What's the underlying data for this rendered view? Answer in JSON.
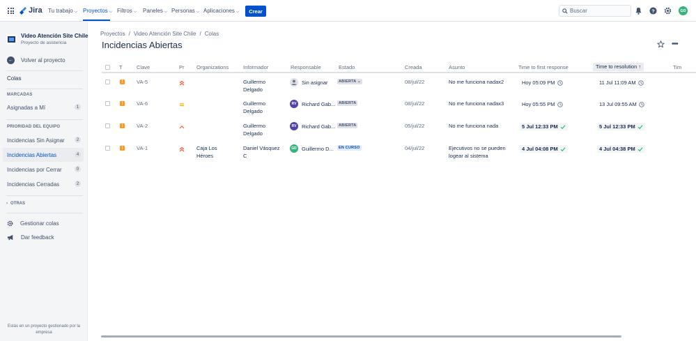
{
  "topnav": {
    "logo": "Jira",
    "items": [
      "Tu trabajo",
      "Proyectos",
      "Filtros",
      "Paneles",
      "Personas",
      "Aplicaciones"
    ],
    "create": "Crear",
    "search_placeholder": "Buscar",
    "user_initials": "GD"
  },
  "sidebar": {
    "project_name": "Video Atención Site Chile",
    "project_type": "Proyecto de asistencia",
    "back": "Volver al proyecto",
    "colas": "Colas",
    "section_marked": "MARCADAS",
    "marked_items": [
      {
        "label": "Asignadas a Mí",
        "count": "1"
      }
    ],
    "section_priority": "PRIORIDAD DEL EQUIPO",
    "priority_items": [
      {
        "label": "Incidencias Sin Asignar",
        "count": "2"
      },
      {
        "label": "Incidencias Abiertas",
        "count": "4"
      },
      {
        "label": "Incidencias por Cerrar",
        "count": "0"
      },
      {
        "label": "Incidencias Cerradas",
        "count": "2"
      }
    ],
    "otras": "OTRAS",
    "manage": "Gestionar colas",
    "feedback": "Dar feedback",
    "footer": "Estás en un proyecto gestionado por la empresa"
  },
  "breadcrumb": [
    "Proyectos",
    "Video Atención Site Chile",
    "Colas"
  ],
  "page_title": "Incidencias Abiertas",
  "table": {
    "headers": {
      "t": "T",
      "key": "Clave",
      "pr": "Pr",
      "org": "Organizations",
      "reporter": "Informador",
      "assignee": "Responsable",
      "status": "Estado",
      "created": "Creada",
      "summary": "Asunto",
      "first_response": "Time to first response",
      "resolution": "Time to resolution",
      "next": "Tim"
    },
    "rows": [
      {
        "key": "VA-5",
        "priority": "highest",
        "org": "",
        "reporter_1": "Guillermo",
        "reporter_2": "Delgado",
        "assignee": "Sin asignar",
        "assignee_initials": "",
        "status": "ABIERTA",
        "created": "08/jul/22",
        "summary_1": "No me funciona nadax2",
        "summary_2": "",
        "first_response": "Hoy 05:09 PM",
        "first_state": "clock",
        "resolution": "11 Jul 11:09 AM",
        "resolution_state": "clock"
      },
      {
        "key": "VA-6",
        "priority": "medium",
        "org": "",
        "reporter_1": "Guillermo",
        "reporter_2": "Delgado",
        "assignee": "Richard Gab...",
        "assignee_initials": "RV",
        "status": "ABIERTA",
        "created": "08/jul/22",
        "summary_1": "No me funciona nadax3",
        "summary_2": "",
        "first_response": "Hoy 05:55 PM",
        "first_state": "clock",
        "resolution": "13 Jul 09:55 AM",
        "resolution_state": "clock"
      },
      {
        "key": "VA-2",
        "priority": "high",
        "org": "",
        "reporter_1": "Guillermo",
        "reporter_2": "Delgado",
        "assignee": "Richard Gab...",
        "assignee_initials": "RV",
        "status": "ABIERTA",
        "created": "05/jul/22",
        "summary_1": "No me funciona nada",
        "summary_2": "",
        "first_response": "5 Jul 12:33 PM",
        "first_state": "check",
        "resolution": "5 Jul 12:33 PM",
        "resolution_state": "check"
      },
      {
        "key": "VA-1",
        "priority": "highest",
        "org_1": "Caja Los",
        "org_2": "Héroes",
        "reporter_1": "Daniel Vásquez",
        "reporter_2": "C",
        "assignee": "Guillermo D...",
        "assignee_initials": "GD",
        "status": "EN CURSO",
        "created": "04/jul/22",
        "summary_1": "Ejecutivos no se pueden",
        "summary_2": "logear al sistema",
        "first_response": "4 Jul 04:08 PM",
        "first_state": "check",
        "resolution": "4 Jul 04:38 PM",
        "resolution_state": "check"
      }
    ]
  },
  "colors": {
    "accent": "#0052cc",
    "sidebar_bg": "#f4f5f7",
    "check": "#36b37e",
    "priority": "#ff5630",
    "priority_medium": "#ffab00",
    "task_icon": "#ff991f"
  }
}
